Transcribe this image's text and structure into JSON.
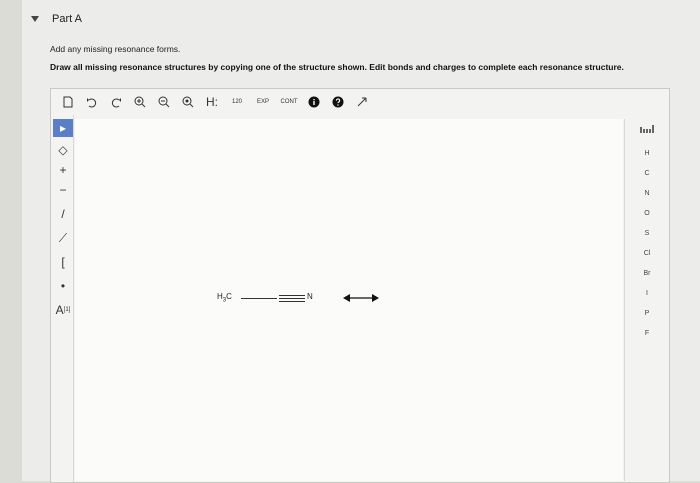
{
  "part": {
    "label": "Part A"
  },
  "instructions": {
    "line1": "Add any missing resonance forms.",
    "line2": "Draw all missing resonance structures by copying one of the structure shown. Edit bonds and charges to complete each resonance structure."
  },
  "toolbar": {
    "icons": [
      "new-doc-icon",
      "undo-icon",
      "redo-icon",
      "zoom-in-icon",
      "zoom-out-icon",
      "zoom-reset-icon"
    ],
    "h_label": "H:",
    "small_labels": {
      "label1": "120",
      "label2": "EXP",
      "label3": "CONT"
    }
  },
  "left_tools": {
    "labels": {
      "plus": "+",
      "minus": "−",
      "atom_label": "A"
    },
    "sup": "[1]"
  },
  "right_panel": {
    "elements": [
      "H",
      "C",
      "N",
      "O",
      "S",
      "Cl",
      "Br",
      "I",
      "P",
      "F"
    ]
  },
  "canvas": {
    "molecule": {
      "left": "H",
      "sub": "3",
      "center": "C",
      "right": "N"
    }
  }
}
